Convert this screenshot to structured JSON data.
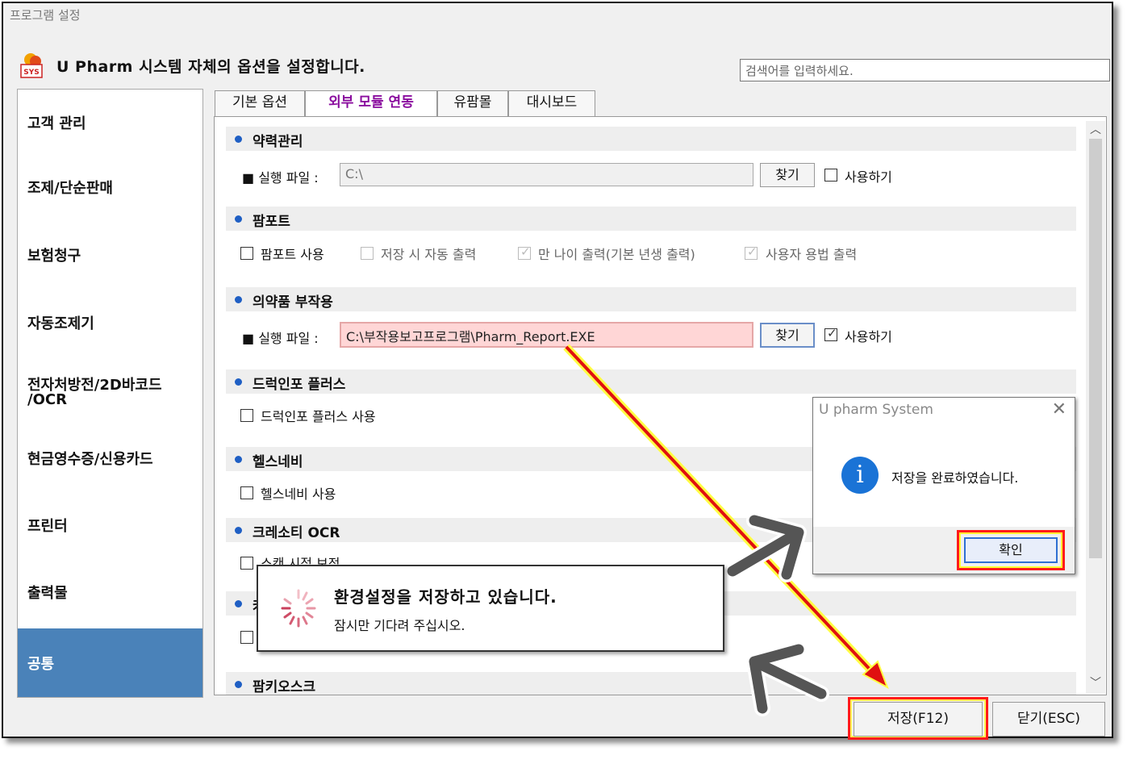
{
  "window": {
    "title": "프로그램 설정",
    "headline": "U Pharm 시스템 자체의 옵션을 설정합니다.",
    "logo_text": "SYS"
  },
  "search": {
    "placeholder": "검색어를 입력하세요."
  },
  "sidebar": {
    "items": [
      {
        "label": "고객 관리"
      },
      {
        "label": "조제/단순판매"
      },
      {
        "label": "보험청구"
      },
      {
        "label": "자동조제기"
      },
      {
        "label": "전자처방전/2D바코드\n/OCR"
      },
      {
        "label": "현금영수증/신용카드"
      },
      {
        "label": "프린터"
      },
      {
        "label": "출력물"
      },
      {
        "label": "공통",
        "active": true
      }
    ]
  },
  "tabs": [
    {
      "label": "기본 옵션"
    },
    {
      "label": "외부 모듈 연동",
      "active": true
    },
    {
      "label": "유팜몰"
    },
    {
      "label": "대시보드"
    }
  ],
  "sections": {
    "yakryeok": {
      "title": "약력관리",
      "exec_label": "■ 실행 파일 :",
      "path": "C:\\",
      "find_label": "찾기",
      "use_label": "사용하기",
      "use_checked": false
    },
    "pampot": {
      "title": "팜포트",
      "opts": [
        {
          "label": "팜포트 사용",
          "checked": false,
          "enabled": true
        },
        {
          "label": "저장 시 자동 출력",
          "checked": false,
          "enabled": false
        },
        {
          "label": "만 나이 출력(기본 년생 출력)",
          "checked": true,
          "enabled": false
        },
        {
          "label": "사용자 용법 출력",
          "checked": true,
          "enabled": false
        }
      ]
    },
    "adverse": {
      "title": "의약품 부작용",
      "exec_label": "■ 실행 파일 :",
      "path": "C:\\부작용보고프로그램\\Pharm_Report.EXE",
      "find_label": "찾기",
      "use_label": "사용하기",
      "use_checked": true
    },
    "druginfo": {
      "title": "드럭인포 플러스",
      "opt": "드럭인포 플러스 사용"
    },
    "healthnavi": {
      "title": "헬스네비",
      "opt": "헬스네비 사용"
    },
    "creasoty": {
      "title": "크레소티 OCR",
      "opt": "스캔 시점 보정"
    },
    "hidden": {
      "title": "커"
    },
    "kiosk": {
      "title": "팜키오스크"
    }
  },
  "dialog": {
    "title": "U pharm System",
    "close": "✕",
    "icon": "info-icon",
    "message": "저장을 완료하였습니다.",
    "ok": "확인"
  },
  "toast": {
    "title": "환경설정을 저장하고 있습니다.",
    "subtitle": "잠시만 기다려 주십시오."
  },
  "footer": {
    "save": "저장(F12)",
    "close": "닫기(ESC)"
  },
  "colors": {
    "accent": "#4a82b9",
    "highlight": "#ff1a1a",
    "tab_active": "#8a0d9e"
  }
}
